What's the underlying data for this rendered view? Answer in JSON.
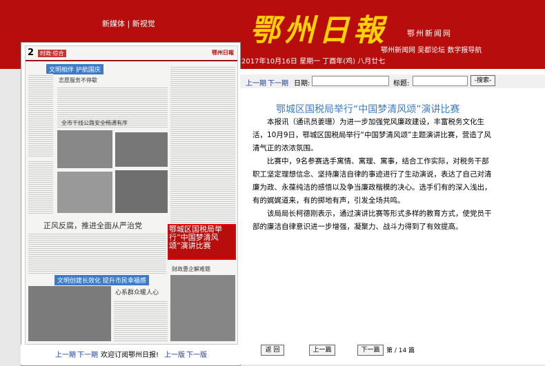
{
  "header": {
    "links_left": "新媒体 | 新视觉",
    "logo": "鄂州日報",
    "net_name": "鄂州新闻网",
    "net_links": "鄂州新闻网  吴都论坛  数字报导航",
    "date": "2017年10月16日 星期一 丁酉年(鸡) 八月廿七"
  },
  "paper": {
    "page_num": "2",
    "section": "时政·综合",
    "masthead": "鄂州日報",
    "headlines": [
      "文明相伴  护航国庆",
      "志愿服务不停歇",
      "全市干线公路安全畅通有序",
      "正风反腐，推进全面从严治党",
      "文明创建长效化  提升市民幸福感",
      "心系群众暖人心",
      "财政惠企解难题"
    ],
    "highlight": "鄂城区国税局举行“中国梦清风颂”演讲比赛"
  },
  "left_nav": {
    "prev_issue": "上一期",
    "next_issue": "下一期",
    "welcome": "欢迎订阅鄂州日报!",
    "prev_page": "上一版",
    "next_page": "下一版"
  },
  "toolbar": {
    "prev_issue": "上一期",
    "next_issue": "下一期",
    "date_label": "日期:",
    "title_label": "标题:",
    "search_button": "-搜索-"
  },
  "article": {
    "title": "鄂城区国税局举行“中国梦清风颂”演讲比赛",
    "paragraphs": [
      "本报讯（通讯员姜珊）为进一步加强党风廉政建设，丰富税务文化生活，10月9日，鄂城区国税局举行“中国梦清风颂”主题演讲比赛，营造了风清气正的浓浓氛围。",
      "比赛中，9名参赛选手寓情、寓理、寓事，结合工作实际，对税务干部职工坚定理想信念、坚持廉洁自律的事迹进行了生动演说，表达了自己对清廉为政、永葆纯洁的感悟以及争当廉政楷模的决心。选手们有的深入浅出，有的娓娓道来，有的掷地有声，引发全场共鸣。",
      "该局局长柯德刚表示，通过演讲比赛等形式多样的教育方式，使党员干部的廉洁自律意识进一步增强，凝聚力、战斗力得到了有效提高。"
    ]
  },
  "bottom": {
    "back": "返 回",
    "prev": "上一篇",
    "next": "下一篇",
    "page_info": "第 / 14 篇"
  }
}
